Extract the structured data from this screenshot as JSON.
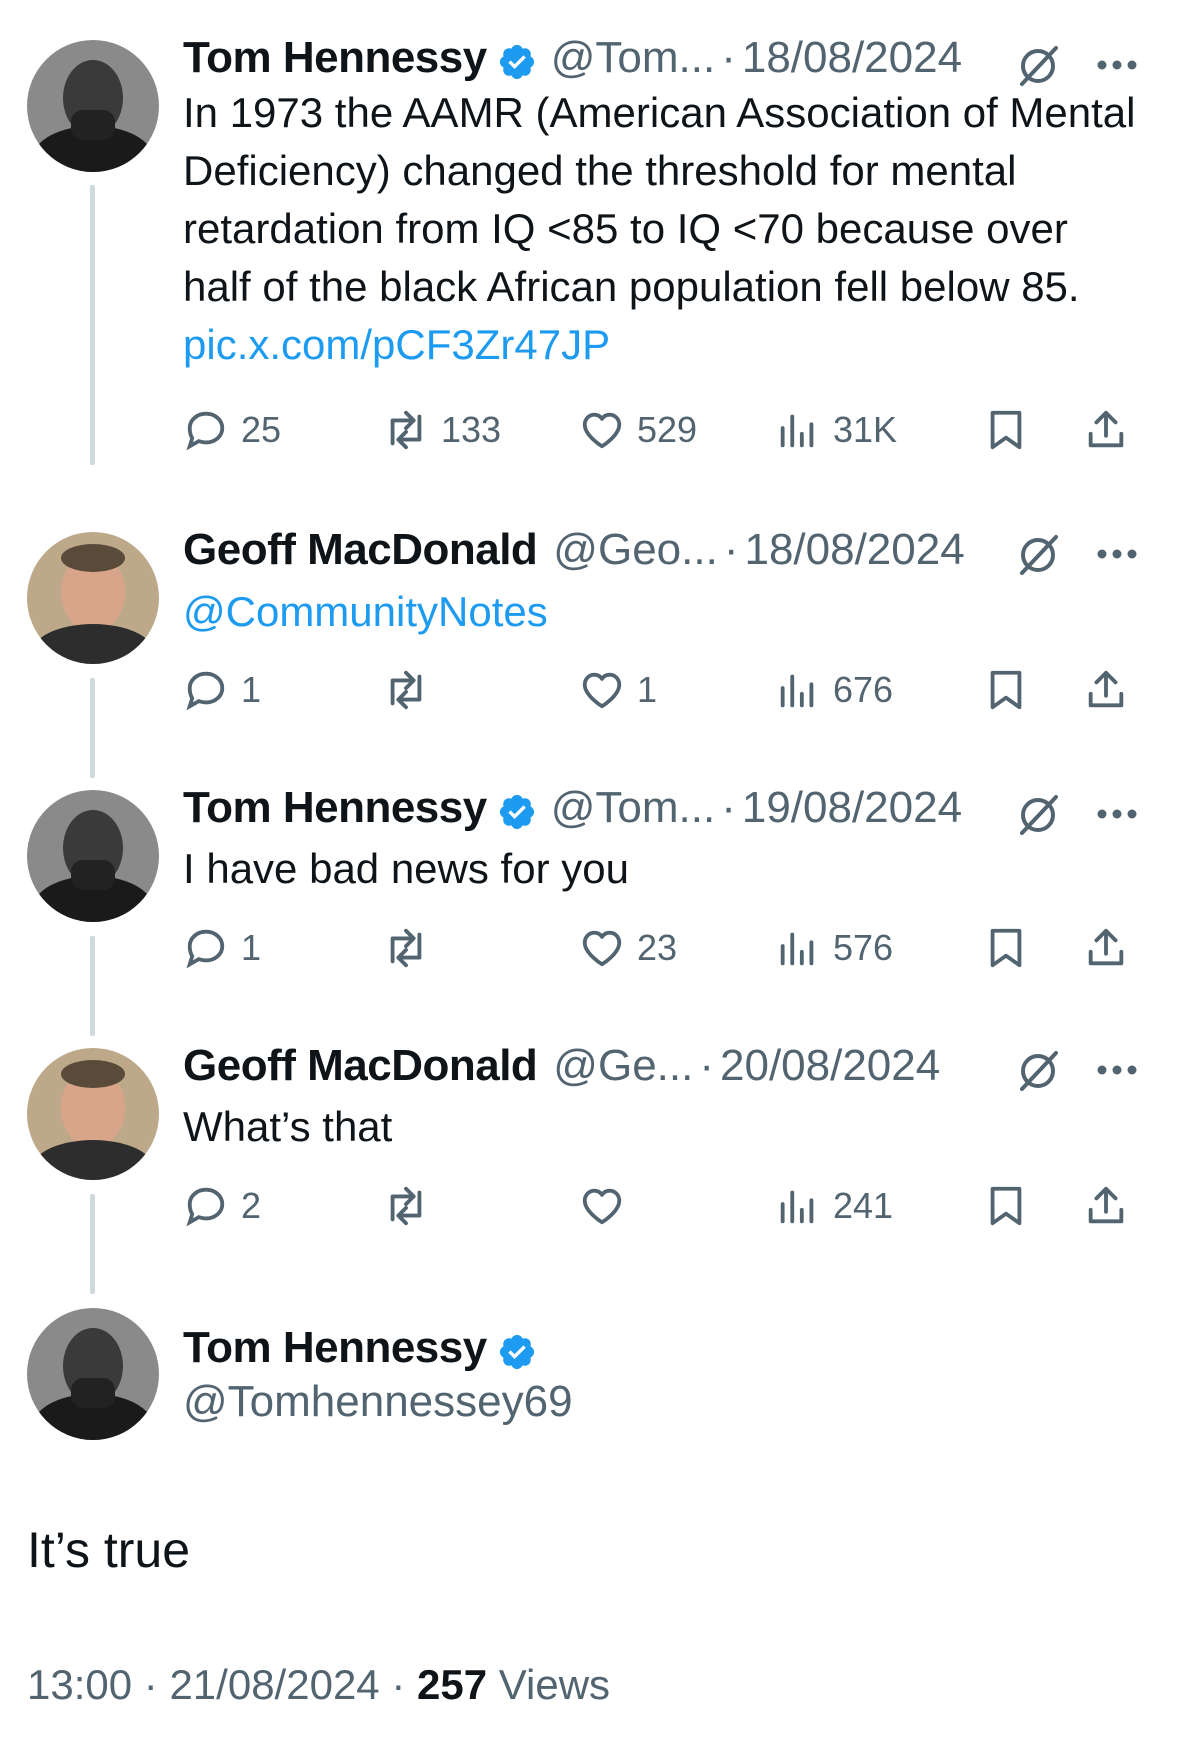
{
  "tweets": [
    {
      "name": "Tom Hennessy",
      "verified": true,
      "handle": "@Tom...",
      "separator": "·",
      "date": "18/08/2024",
      "text": "In 1973 the AAMR (American Association of Mental Deficiency) changed the threshold for mental retardation from IQ <85 to IQ <70 because over half of the black African population fell below 85. ",
      "link": "pic.x.com/pCF3Zr47JP",
      "replies": "25",
      "reposts": "133",
      "likes": "529",
      "views": "31K"
    },
    {
      "name": "Geoff MacDonald",
      "verified": false,
      "handle": "@Geo...",
      "separator": "·",
      "date": "18/08/2024",
      "link": "@CommunityNotes",
      "replies": "1",
      "reposts": "",
      "likes": "1",
      "views": "676"
    },
    {
      "name": "Tom Hennessy",
      "verified": true,
      "handle": "@Tom...",
      "separator": "·",
      "date": "19/08/2024",
      "text": "I have bad news for you",
      "replies": "1",
      "reposts": "",
      "likes": "23",
      "views": "576"
    },
    {
      "name": "Geoff MacDonald",
      "verified": false,
      "handle": "@Ge...",
      "separator": "·",
      "date": "20/08/2024",
      "text": "What’s that",
      "replies": "2",
      "reposts": "",
      "likes": "",
      "views": "241"
    }
  ],
  "main": {
    "name": "Tom Hennessy",
    "verified": true,
    "handle": "@Tomhennessey69",
    "text": "It’s true",
    "time": "13:00",
    "separator": "·",
    "date": "21/08/2024",
    "views_count": "257",
    "views_label": "Views"
  },
  "colors": {
    "accent": "#1d9bf0",
    "secondary_text": "#536471",
    "connector": "#cfd9de"
  },
  "icons": [
    "verified-badge-icon",
    "grok-icon",
    "more-icon",
    "reply-icon",
    "repost-icon",
    "like-icon",
    "views-icon",
    "bookmark-icon",
    "share-icon"
  ]
}
